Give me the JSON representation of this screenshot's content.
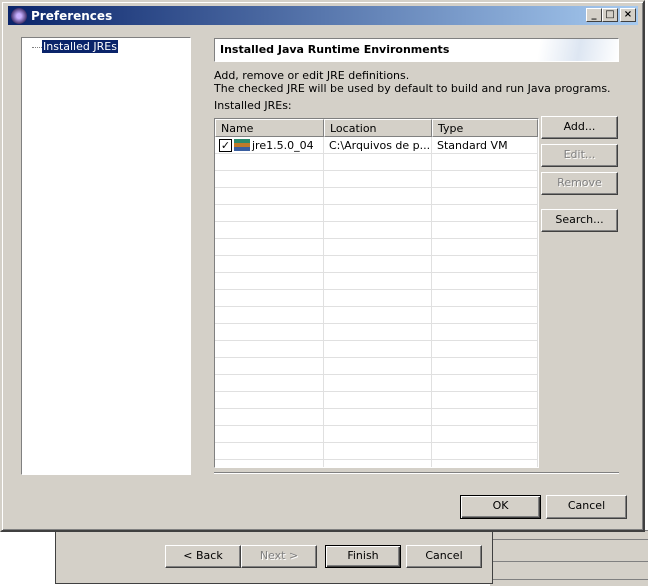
{
  "window": {
    "title": "Preferences",
    "minimize": "_",
    "maximize": "□",
    "close": "×"
  },
  "tree": {
    "items": [
      {
        "label": "Installed JREs",
        "selected": true
      }
    ]
  },
  "page": {
    "title": "Installed Java Runtime Environments",
    "description_line1": "Add, remove or edit JRE definitions.",
    "description_line2": "The checked JRE will be used by default to build and run Java programs.",
    "list_label": "Installed JREs:",
    "columns": [
      "Name",
      "Location",
      "Type"
    ],
    "rows": [
      {
        "checked": true,
        "name": "jre1.5.0_04",
        "location": "C:\\Arquivos de p...",
        "type": "Standard VM"
      }
    ],
    "buttons": {
      "add": "Add...",
      "edit": "Edit...",
      "remove": "Remove",
      "search": "Search..."
    }
  },
  "footer": {
    "ok": "OK",
    "cancel": "Cancel"
  },
  "wizard": {
    "back": "< Back",
    "next": "Next >",
    "finish": "Finish",
    "cancel": "Cancel"
  }
}
